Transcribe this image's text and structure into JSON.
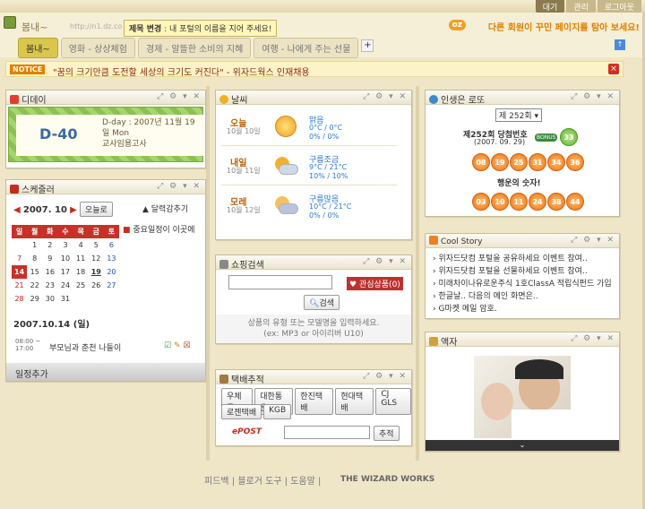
{
  "topbar": {
    "tabs": [
      "대기",
      "관리",
      "로그아웃"
    ]
  },
  "header": {
    "blog_name": "봄내~",
    "blog_url": "http://n1.dz.co",
    "tooltip_label": "제목 변경",
    "tooltip_text": " : 내 포털의 이름을 지어 주세요!",
    "oz_badge": "oz",
    "promo": "다른 회원이 꾸민 페이지를 탐아 보세요!",
    "tabs": [
      "봄내~",
      "영화 - 상상체험",
      "경제 - 알뜰한 소비의 지혜",
      "여행 - 나에게 주는 선물"
    ],
    "add_tab": "+",
    "up_button": "↑"
  },
  "notice": {
    "tag": "NOTICE",
    "text": "\"꿈의 크기만큼 도전할 세상의 크기도 커진다\" - 위자드웍스 인재채용",
    "close": "×"
  },
  "dday": {
    "title": "디데이",
    "count": "D-40",
    "line1": "D-day : 2007년 11월 19",
    "line2": "일 Mon",
    "line3": "교사임용고사"
  },
  "weather": {
    "title": "날씨",
    "rows": [
      {
        "day": "오늘",
        "date": "10월 10일",
        "cond": "맑음",
        "temp": "0°C / 0°C",
        "rain": "0% / 0%",
        "icon": "sun-icon"
      },
      {
        "day": "내일",
        "date": "10월 11일",
        "cond": "구름조금",
        "temp": "9°C / 21°C",
        "rain": "10% / 10%",
        "icon": "partly-cloudy-icon"
      },
      {
        "day": "모레",
        "date": "10월 12일",
        "cond": "구름많음",
        "temp": "10°C / 21°C",
        "rain": "0% / 0%",
        "icon": "cloudy-icon"
      }
    ]
  },
  "lotto": {
    "title": "인생은 로또",
    "round_select": "제 252회",
    "winning_title": "제252회 당첨번호",
    "winning_date": "(2007. 09. 29)",
    "bonus_label": "BONUS",
    "bonus": "33",
    "numbers": [
      "08",
      "19",
      "25",
      "31",
      "34",
      "36"
    ],
    "lucky_title": "행운의 숫자!",
    "lucky": [
      "03",
      "10",
      "11",
      "24",
      "38",
      "44"
    ]
  },
  "schedule": {
    "title": "스케줄러",
    "month": "2007. 10",
    "today_btn": "오늘로",
    "fold": "▲ 달력감추기",
    "weekdays": [
      "일",
      "월",
      "화",
      "수",
      "목",
      "금",
      "토"
    ],
    "weeks": [
      [
        "",
        "1",
        "2",
        "3",
        "4",
        "5",
        "6"
      ],
      [
        "7",
        "8",
        "9",
        "10",
        "11",
        "12",
        "13"
      ],
      [
        "14",
        "15",
        "16",
        "17",
        "18",
        "19",
        "20"
      ],
      [
        "21",
        "22",
        "23",
        "24",
        "25",
        "26",
        "27"
      ],
      [
        "28",
        "29",
        "30",
        "31",
        "",
        "",
        ""
      ]
    ],
    "important": "중요일정이 이곳에",
    "date_title": "2007.10.14 (일)",
    "time": "08:00 ~",
    "time2": "17:00",
    "event": "부모님과 춘천 나들이",
    "add_btn": "일정추가"
  },
  "shopping": {
    "title": "쇼핑검색",
    "fav": "관심상품(0)",
    "search_btn": "검색",
    "hint1": "상품의 유형 또는 모델명을 입력하세요.",
    "hint2": "(ex: MP3 or 아이리버 U10)"
  },
  "coolstory": {
    "title": "Cool Story",
    "items": [
      "위자드닷컴 포털을 공유하세요 이벤트 참여..",
      "위자드닷컴 포털을 선물하세요 이벤트 참여..",
      "미래차이나유로운주식 1호ClassA 적립식펀드 가입..",
      "한글날.. 다음의 메인 화면은..",
      "G마켓 메일 암호."
    ]
  },
  "delivery": {
    "title": "택배추적",
    "row1": [
      "우체국",
      "대한통운",
      "한진택배",
      "현대택배",
      "CJ GLS"
    ],
    "row2": [
      "로젠택배",
      "KGB"
    ],
    "epost": "ePOST",
    "track_btn": "추적"
  },
  "photo": {
    "title": "액자"
  },
  "footer": {
    "links": "피드백 | 블로거 도구 | 도움말 |",
    "brand": "THE WIZARD WORKS"
  }
}
